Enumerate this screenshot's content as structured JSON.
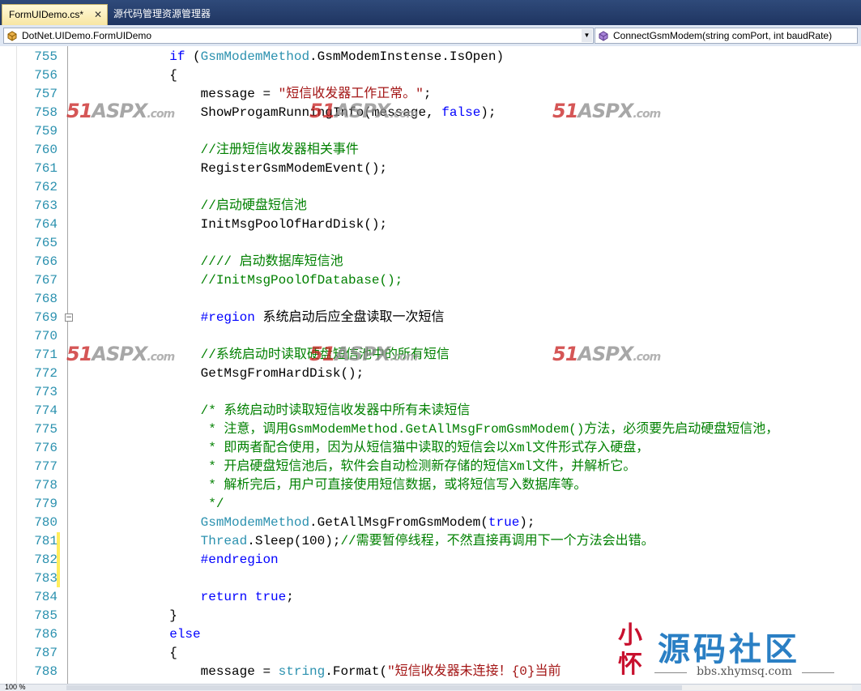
{
  "tabs": [
    {
      "label": "FormUIDemo.cs*",
      "active": true
    },
    {
      "label": "源代码管理资源管理器",
      "active": false
    }
  ],
  "navbar": {
    "class_combo": "DotNet.UIDemo.FormUIDemo",
    "member_combo": "ConnectGsmModem(string comPort, int baudRate)"
  },
  "code_lines": [
    {
      "num": "755",
      "html": "            <span class=\"k\">if</span> (<span class=\"t\">GsmModemMethod</span>.GsmModemInstense.IsOpen)"
    },
    {
      "num": "756",
      "html": "            {"
    },
    {
      "num": "757",
      "html": "                message = <span class=\"s\">\"短信收发器工作正常。\"</span>;"
    },
    {
      "num": "758",
      "html": "                ShowProgamRunningInfo(message, <span class=\"k\">false</span>);"
    },
    {
      "num": "759",
      "html": ""
    },
    {
      "num": "760",
      "html": "                <span class=\"c\">//注册短信收发器相关事件</span>"
    },
    {
      "num": "761",
      "html": "                RegisterGsmModemEvent();"
    },
    {
      "num": "762",
      "html": ""
    },
    {
      "num": "763",
      "html": "                <span class=\"c\">//启动硬盘短信池</span>"
    },
    {
      "num": "764",
      "html": "                InitMsgPoolOfHardDisk();"
    },
    {
      "num": "765",
      "html": ""
    },
    {
      "num": "766",
      "html": "                <span class=\"c\">//// 启动数据库短信池</span>"
    },
    {
      "num": "767",
      "html": "                <span class=\"c\">//InitMsgPoolOfDatabase();</span>"
    },
    {
      "num": "768",
      "html": ""
    },
    {
      "num": "769",
      "html": "                <span class=\"k\">#region</span> 系统启动后应全盘读取一次短信"
    },
    {
      "num": "770",
      "html": ""
    },
    {
      "num": "771",
      "html": "                <span class=\"c\">//系统启动时读取硬盘短信池中的所有短信</span>"
    },
    {
      "num": "772",
      "html": "                GetMsgFromHardDisk();"
    },
    {
      "num": "773",
      "html": ""
    },
    {
      "num": "774",
      "html": "                <span class=\"c\">/* 系统启动时读取短信收发器中所有未读短信</span>"
    },
    {
      "num": "775",
      "html": "<span class=\"c\">                 * 注意，调用GsmModemMethod.GetAllMsgFromGsmModem()方法，必须要先启动硬盘短信池，</span>"
    },
    {
      "num": "776",
      "html": "<span class=\"c\">                 * 即两者配合使用，因为从短信猫中读取的短信会以Xml文件形式存入硬盘，</span>"
    },
    {
      "num": "777",
      "html": "<span class=\"c\">                 * 开启硬盘短信池后，软件会自动检测新存储的短信Xml文件，并解析它。</span>"
    },
    {
      "num": "778",
      "html": "<span class=\"c\">                 * 解析完后，用户可直接使用短信数据，或将短信写入数据库等。</span>"
    },
    {
      "num": "779",
      "html": "<span class=\"c\">                 */</span>"
    },
    {
      "num": "780",
      "html": "                <span class=\"t\">GsmModemMethod</span>.GetAllMsgFromGsmModem(<span class=\"k\">true</span>);"
    },
    {
      "num": "781",
      "html": "                <span class=\"t\">Thread</span>.Sleep(100);<span class=\"c\">//需要暂停线程，不然直接再调用下一个方法会出错。</span>"
    },
    {
      "num": "782",
      "html": "                <span class=\"k\">#endregion</span>"
    },
    {
      "num": "783",
      "html": ""
    },
    {
      "num": "784",
      "html": "                <span class=\"k\">return</span> <span class=\"k\">true</span>;"
    },
    {
      "num": "785",
      "html": "            }"
    },
    {
      "num": "786",
      "html": "            <span class=\"k\">else</span>"
    },
    {
      "num": "787",
      "html": "            {"
    },
    {
      "num": "788",
      "html": "                message = <span class=\"t\">string</span>.Format(<span class=\"s\">\"短信收发器未连接！{0}当前</span>"
    }
  ],
  "watermarks": {
    "num": "51",
    "aspx": "ASPX",
    "com": ".com"
  },
  "logo": {
    "seal": "小怀",
    "title": "源码社区",
    "url": "bbs.xhymsq.com"
  },
  "status": {
    "zoom": "100 %"
  }
}
